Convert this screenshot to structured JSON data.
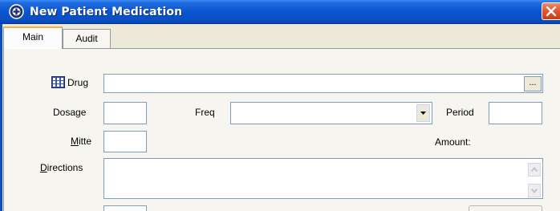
{
  "window": {
    "title": "New Patient Medication"
  },
  "tabs": [
    {
      "label": "Main"
    },
    {
      "label": "Audit"
    }
  ],
  "form": {
    "drug": {
      "label": "Drug",
      "value": "",
      "browse_label": "..."
    },
    "dosage": {
      "label": "Dosage",
      "value": ""
    },
    "freq": {
      "label": "Freq",
      "value": ""
    },
    "period": {
      "label": "Period",
      "value": ""
    },
    "mitte": {
      "label_first": "M",
      "label_rest": "itte",
      "value": ""
    },
    "amount": {
      "label": "Amount:"
    },
    "directions": {
      "label_first": "D",
      "label_rest": "irections",
      "value": ""
    }
  },
  "colors": {
    "titlebar": "#0a55d0",
    "close_button": "#e2542f",
    "dialog_bg": "#ece9d8",
    "field_border": "#7f9db9"
  },
  "icons": {
    "app": "plus-circle-icon",
    "close": "close-icon",
    "drug": "drug-grid-icon",
    "dropdown": "chevron-down-icon",
    "scroll_up": "scroll-up-icon",
    "scroll_down": "scroll-down-icon"
  }
}
